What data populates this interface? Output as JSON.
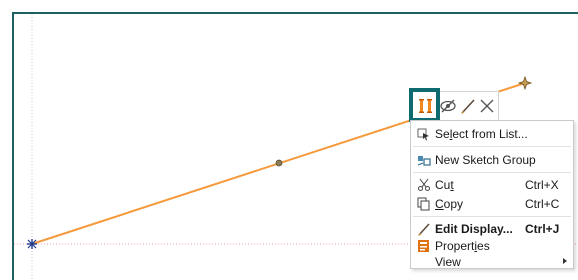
{
  "colors": {
    "frame": "#1e5f63",
    "sketch_line": "#f59a3c",
    "highlight": "#0e6b6f"
  },
  "mini_toolbar": {
    "buttons": [
      {
        "name": "edit-dimensions-icon",
        "icon": "orange-bars"
      },
      {
        "name": "hide-icon",
        "icon": "eye-slash"
      },
      {
        "name": "edit-display-icon",
        "icon": "brush"
      },
      {
        "name": "delete-icon",
        "icon": "x"
      }
    ]
  },
  "menu": {
    "items": [
      {
        "pre": "Se",
        "ul": "l",
        "post": "ect from List...",
        "shortcut": ""
      },
      {
        "label": "New Sketch Group",
        "shortcut": ""
      },
      {
        "pre": "Cu",
        "ul": "t",
        "post": "",
        "shortcut": "Ctrl+X"
      },
      {
        "pre": "",
        "ul": "C",
        "post": "opy",
        "shortcut": "Ctrl+C"
      },
      {
        "label": "Edit Display...",
        "shortcut": "Ctrl+J"
      },
      {
        "pre": "Propert",
        "ul": "i",
        "post": "es",
        "shortcut": ""
      },
      {
        "label": "View",
        "shortcut": ""
      }
    ]
  }
}
